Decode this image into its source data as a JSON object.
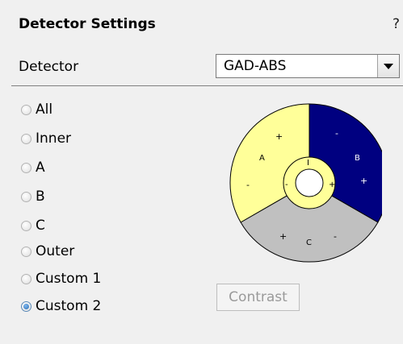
{
  "panel": {
    "title": "Detector Settings",
    "help": "?"
  },
  "detector": {
    "label": "Detector",
    "selected": "GAD-ABS"
  },
  "radios": [
    {
      "label": "All",
      "checked": false
    },
    {
      "label": "Inner",
      "checked": false
    },
    {
      "label": "A",
      "checked": false
    },
    {
      "label": "B",
      "checked": false
    },
    {
      "label": "C",
      "checked": false
    },
    {
      "label": "Outer",
      "checked": false
    },
    {
      "label": "Custom 1",
      "checked": false
    },
    {
      "label": "Custom 2",
      "checked": true
    }
  ],
  "diagram": {
    "segment_a": {
      "label": "A",
      "color": "#ffff99"
    },
    "segment_b": {
      "label": "B",
      "color": "#000080"
    },
    "segment_c": {
      "label": "C",
      "color": "#c0c0c0"
    },
    "inner": {
      "label": "I",
      "color": "#ffff99"
    },
    "signs": {
      "a_top": "+",
      "a_left": "-",
      "b_top": "-",
      "b_right": "+",
      "c_left": "+",
      "c_right": "-",
      "inner_left": "-",
      "inner_right": "+"
    }
  },
  "contrast_button": {
    "label": "Contrast",
    "enabled": false
  }
}
